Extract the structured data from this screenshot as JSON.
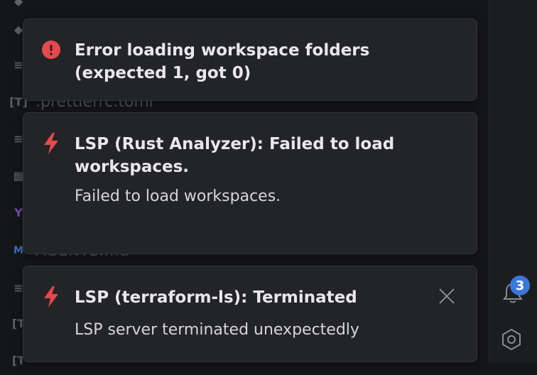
{
  "filetree": {
    "files": [
      {
        "icon": "list-icon",
        "label": ""
      },
      {
        "icon": "toml-icon",
        "label": ".prettierrc.toml"
      },
      {
        "icon": "list-icon",
        "label": ""
      },
      {
        "icon": "markdown-icon",
        "label": "AGENTS.md"
      },
      {
        "icon": "list-icon",
        "label": ""
      }
    ]
  },
  "notifications": [
    {
      "icon": "error-circle-icon",
      "title": "Error loading workspace folders (expected 1, got 0)",
      "body": ""
    },
    {
      "icon": "lightning-icon",
      "title": "LSP (Rust Analyzer): Failed to load workspaces.",
      "body": "Failed to load workspaces."
    },
    {
      "icon": "lightning-icon",
      "title": "LSP (terraform-ls): Terminated",
      "body": "LSP server terminated unexpectedly"
    }
  ],
  "activity_bar": {
    "notification_count": "3"
  },
  "colors": {
    "error": "#e5484d",
    "accent": "#3a78d8"
  }
}
